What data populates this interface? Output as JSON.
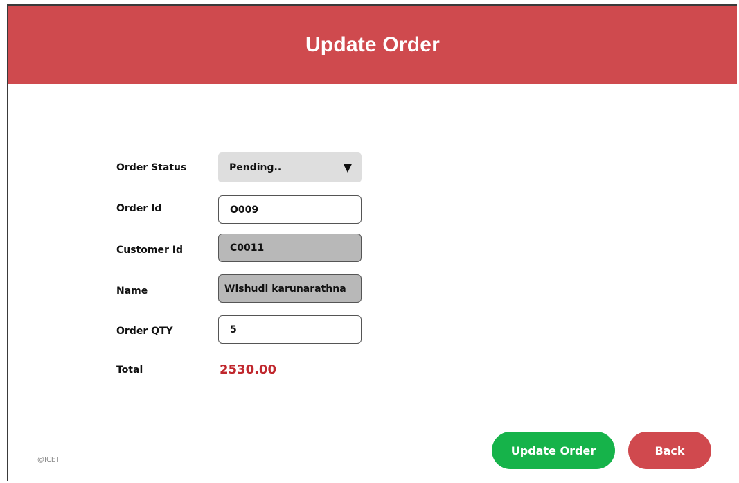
{
  "header": {
    "title": "Update Order"
  },
  "form": {
    "order_status": {
      "label": "Order Status",
      "selected": "Pending.."
    },
    "order_id": {
      "label": "Order Id",
      "value": "O009"
    },
    "customer_id": {
      "label": "Customer Id",
      "value": "C0011"
    },
    "name": {
      "label": "Name",
      "value": "Wishudi karunarathna"
    },
    "order_qty": {
      "label": "Order QTY",
      "value": "5"
    },
    "total": {
      "label": "Total",
      "value": "2530.00"
    }
  },
  "actions": {
    "update_label": "Update Order",
    "back_label": "Back"
  },
  "footer": {
    "mark": "@ICET"
  },
  "colors": {
    "header_bg": "#cf4a4e",
    "update_button": "#16b34a",
    "back_button": "#d0494e",
    "total_text": "#c0272d"
  },
  "icons": {
    "dropdown": "triangle-down"
  }
}
